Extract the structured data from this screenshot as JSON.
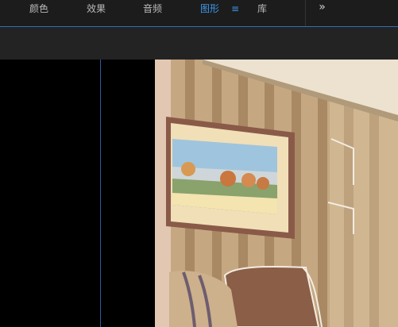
{
  "tabs": [
    {
      "label": "颜色",
      "active": false
    },
    {
      "label": "效果",
      "active": false
    },
    {
      "label": "音频",
      "active": false
    },
    {
      "label": "图形",
      "active": true
    },
    {
      "label": "库",
      "active": false
    }
  ],
  "tab_menu_glyph": "≡",
  "more_glyph": "»",
  "colors": {
    "active_tab": "#3d97ea",
    "inactive_tab": "#b9b9b9",
    "panel_bg": "#1c1c1c",
    "guide_line": "#2d5aa4"
  }
}
